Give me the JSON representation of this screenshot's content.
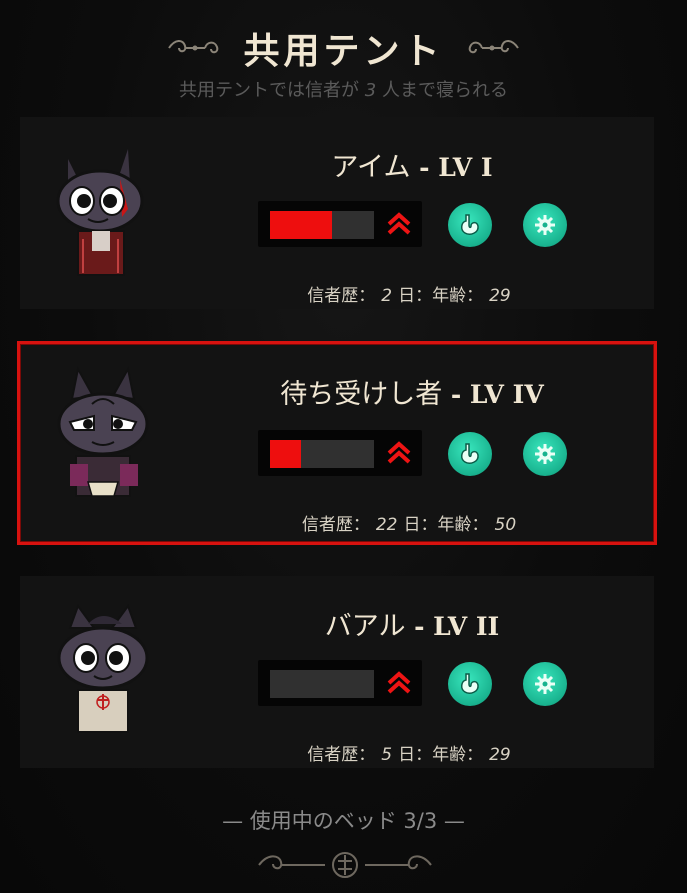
{
  "header": {
    "title": "共用テント",
    "subtitle_pre": "共用テントでは信者が",
    "subtitle_num": "3",
    "subtitle_post": "人まで寝られる"
  },
  "followers": [
    {
      "name": "アイム",
      "level": "- LV I",
      "stat_fill_fraction": 0.6,
      "history_label": "信者歴：",
      "days": "2",
      "days_label": "日：年齢：",
      "age": "29"
    },
    {
      "name": "待ち受けし者",
      "level": "- LV IV",
      "stat_fill_fraction": 0.3,
      "history_label": "信者歴：",
      "days": "22",
      "days_label": "日：年齢：",
      "age": "50",
      "selected": true
    },
    {
      "name": "バアル",
      "level": "- LV II",
      "stat_fill_fraction": 0.0,
      "history_label": "信者歴：",
      "days": "5",
      "days_label": "日：年齢：",
      "age": "29"
    }
  ],
  "footer": {
    "beds_label": "— 使用中のベッド 3/3 —"
  },
  "icons": {
    "level_up": "double-chevron-up-icon",
    "stomach": "stomach-icon",
    "gear": "gear-icon"
  },
  "colors": {
    "accent_red": "#ee0e0e",
    "icon_teal": "#19b38f",
    "title_text": "#f0e6d2"
  }
}
